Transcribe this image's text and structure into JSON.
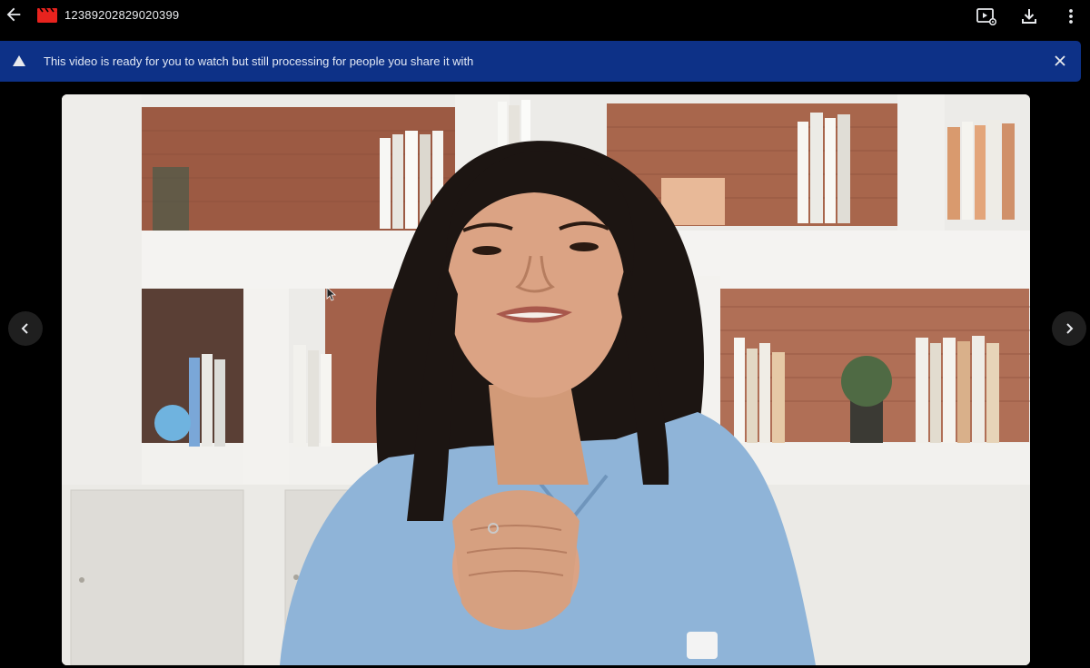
{
  "header": {
    "title": "12389202829020399",
    "back_icon": "arrow-left-icon",
    "file_icon": "video-clapper-icon",
    "file_icon_color": "#e8231e",
    "actions": [
      {
        "name": "open-in-player-button",
        "icon": "video-settings-icon"
      },
      {
        "name": "download-button",
        "icon": "download-icon"
      },
      {
        "name": "more-options-button",
        "icon": "more-vert-icon"
      }
    ]
  },
  "banner": {
    "message": "This video is ready for you to watch but still processing for people you share it with",
    "icon": "warning-triangle-icon",
    "close_icon": "close-icon",
    "background": "#0d3187"
  },
  "viewer": {
    "prev_icon": "chevron-left-icon",
    "next_icon": "chevron-right-icon"
  },
  "colors": {
    "background": "#000000",
    "text": "#e8eaed"
  }
}
